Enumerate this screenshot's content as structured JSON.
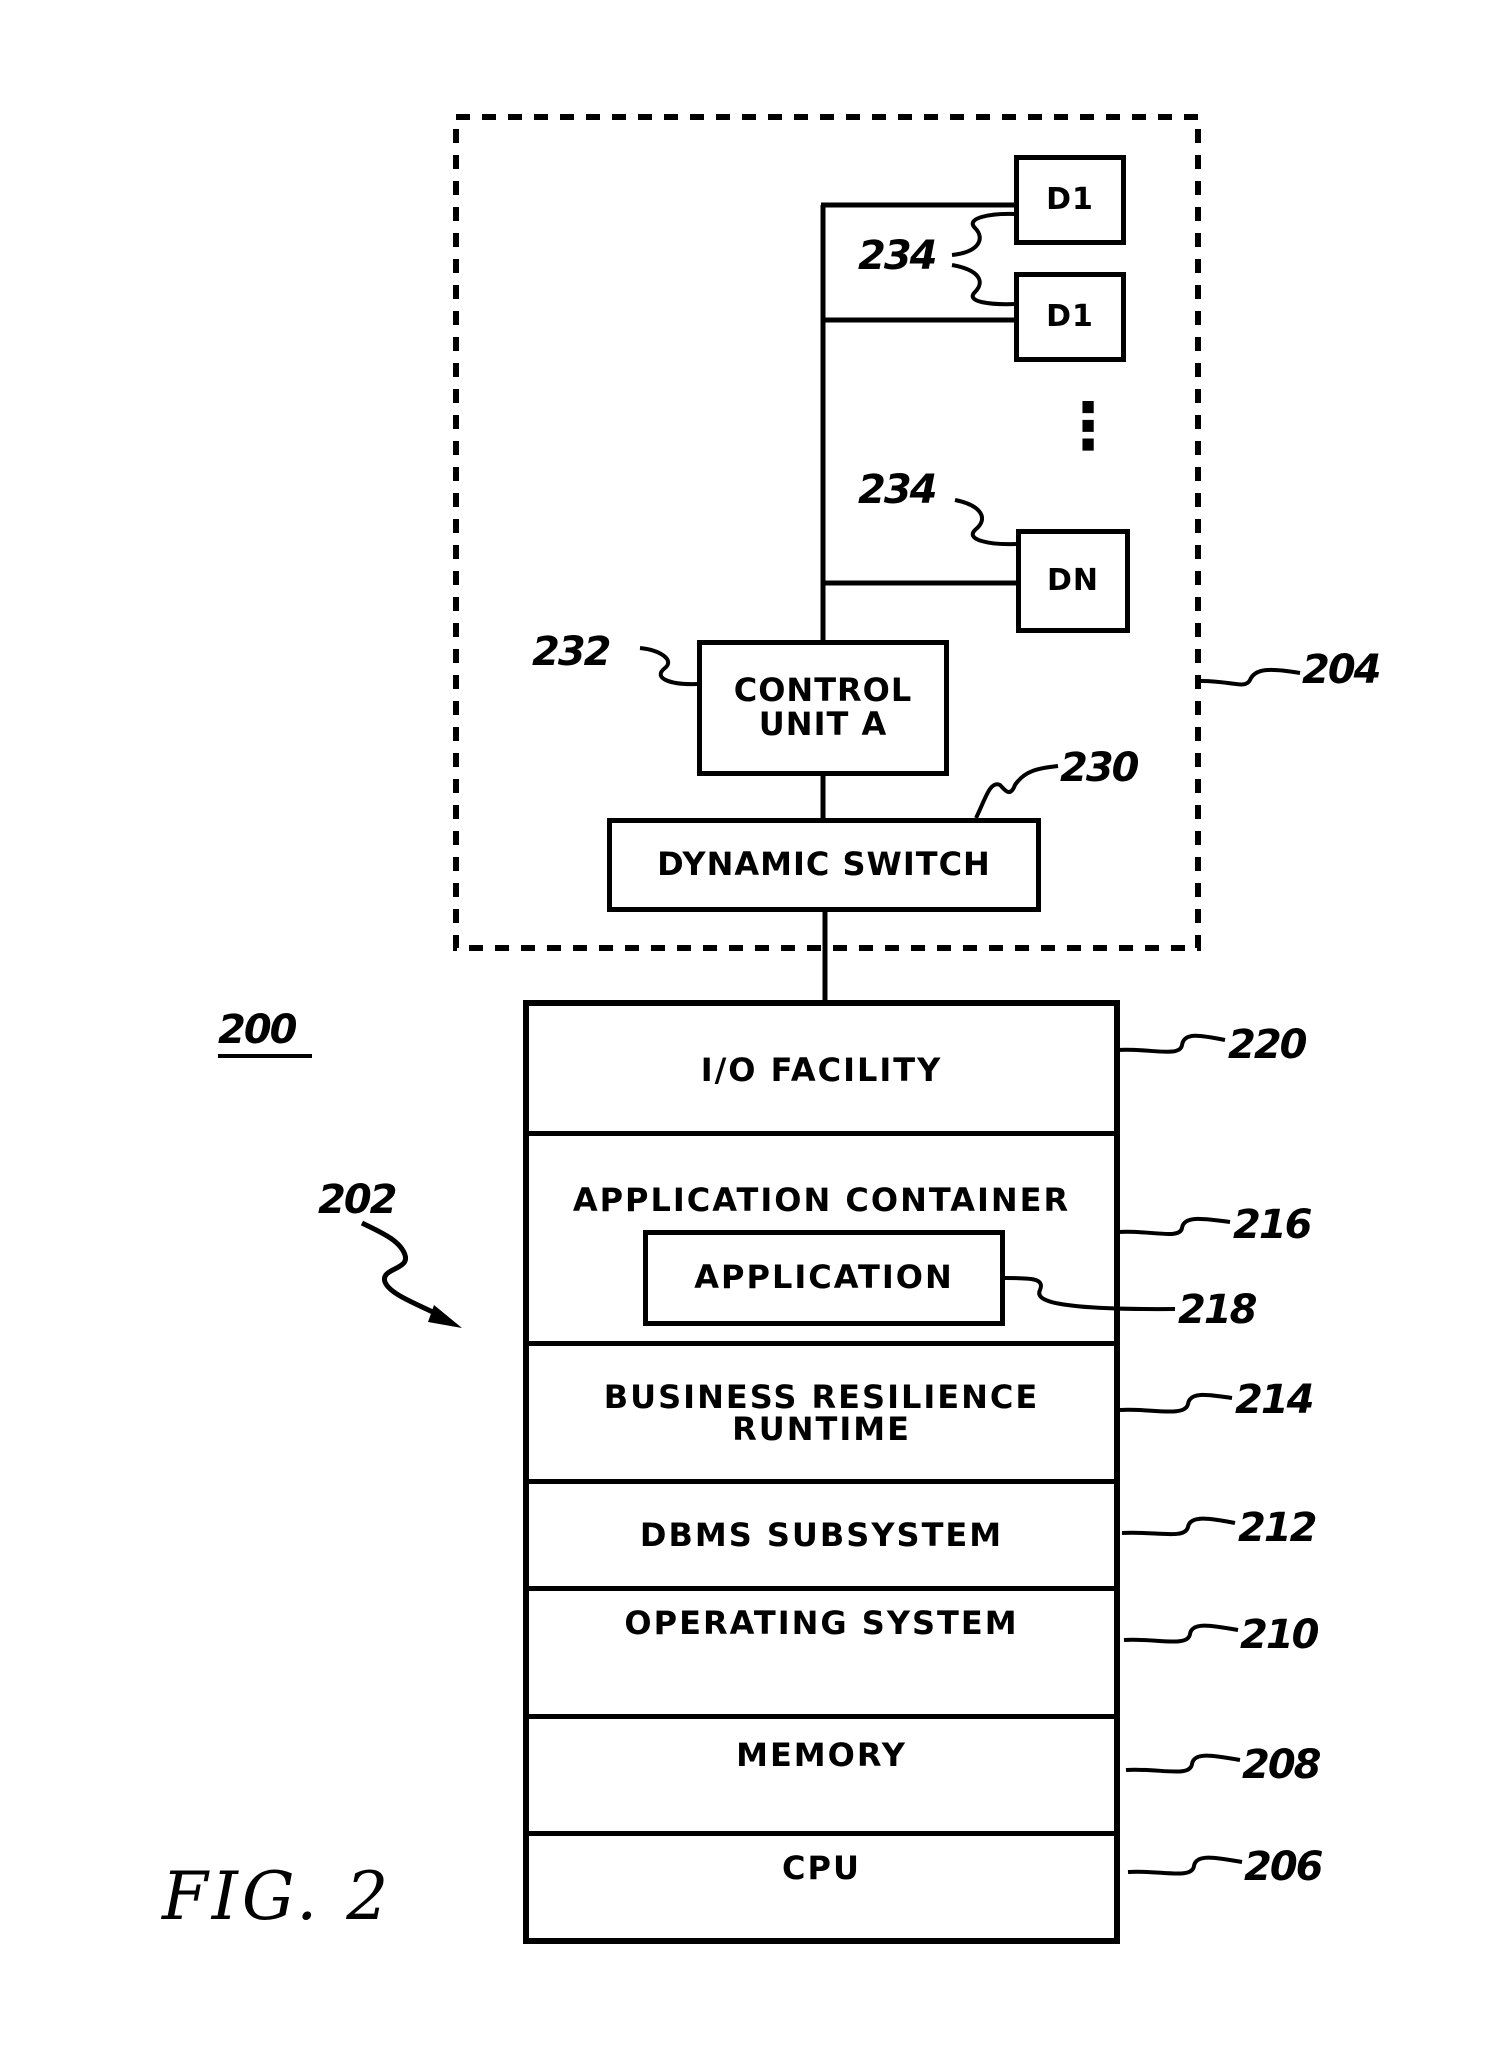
{
  "figure": {
    "caption": "FIG. 2",
    "system_ref": "200",
    "computer_ref": "202"
  },
  "storage_subsystem": {
    "ref": "204",
    "devices": [
      {
        "label": "D1",
        "ref": "234"
      },
      {
        "label": "D1",
        "ref": "234"
      },
      {
        "label": "DN",
        "ref": "234"
      }
    ],
    "ellipsis": "⋮",
    "control_unit": {
      "label_line1": "CONTROL",
      "label_line2": "UNIT A",
      "ref": "232"
    },
    "dynamic_switch": {
      "label": "DYNAMIC SWITCH",
      "ref": "230"
    }
  },
  "stack": {
    "layers": [
      {
        "label": "I/O FACILITY",
        "ref": "220"
      },
      {
        "label": "APPLICATION CONTAINER",
        "ref": "216"
      },
      {
        "label_line1": "BUSINESS RESILIENCE",
        "label_line2": "RUNTIME",
        "ref": "214"
      },
      {
        "label": "DBMS SUBSYSTEM",
        "ref": "212"
      },
      {
        "label": "OPERATING SYSTEM",
        "ref": "210"
      },
      {
        "label": "MEMORY",
        "ref": "208"
      },
      {
        "label": "CPU",
        "ref": "206"
      }
    ],
    "application": {
      "label": "APPLICATION",
      "ref": "218"
    }
  }
}
